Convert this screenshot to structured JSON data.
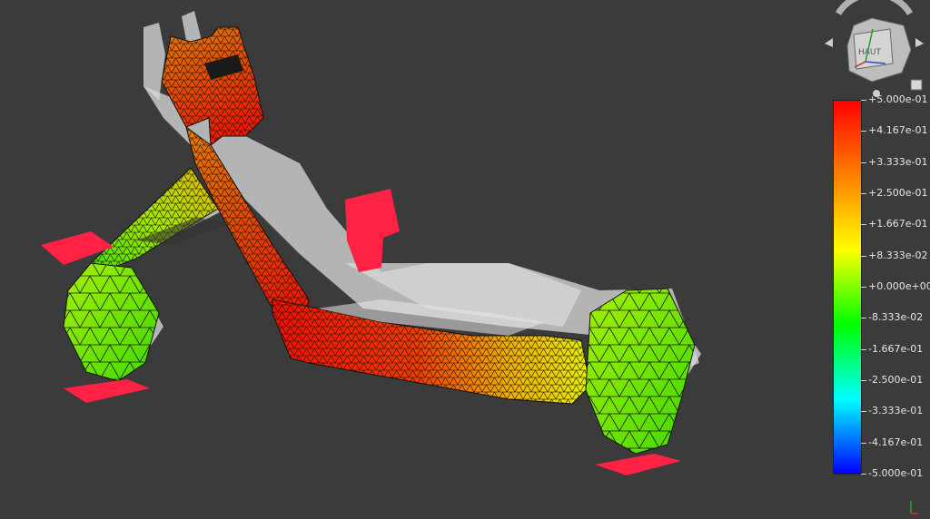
{
  "viewcube": {
    "face_label": "HAUT"
  },
  "colorbar": {
    "ticks": [
      "+5.000e-01",
      "+4.167e-01",
      "+3.333e-01",
      "+2.500e-01",
      "+1.667e-01",
      "+8.333e-02",
      "+0.000e+00",
      "-8.333e-02",
      "-1.667e-01",
      "-2.500e-01",
      "-3.333e-01",
      "-4.167e-01",
      "-5.000e-01"
    ],
    "min": -0.5,
    "max": 0.5,
    "colors": [
      "#ff0000",
      "#ff7f00",
      "#ffff00",
      "#00ff00",
      "#00ffff",
      "#0000ff"
    ]
  },
  "colors": {
    "background": "#3b3b3b",
    "load_marker": "#ff2244",
    "ghost_body": "#d4d4d4"
  }
}
